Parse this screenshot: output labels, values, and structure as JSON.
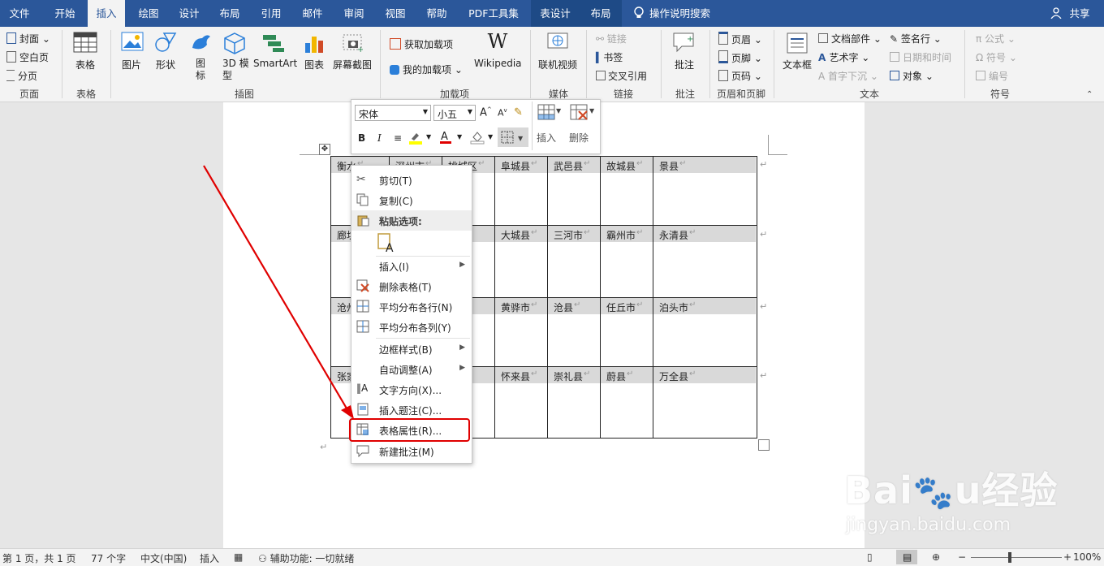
{
  "tabs": [
    "文件",
    "开始",
    "插入",
    "绘图",
    "设计",
    "布局",
    "引用",
    "邮件",
    "审阅",
    "视图",
    "帮助",
    "PDF工具集",
    "表设计",
    "布局"
  ],
  "tell_me": "操作说明搜索",
  "share": "共享",
  "ribbon": {
    "pages": {
      "label": "页面",
      "items": [
        "封面",
        "空白页",
        "分页"
      ]
    },
    "tables": {
      "label": "表格",
      "table": "表格"
    },
    "illustrations": {
      "label": "插图",
      "picture": "图片",
      "shapes": "形状",
      "icons": "图\n标",
      "model3d": "3D 模\n型",
      "smartart": "SmartArt",
      "chart": "图表",
      "screenshot": "屏幕截图"
    },
    "addins": {
      "label": "加载项",
      "get": "获取加载项",
      "mine": "我的加载项",
      "wikipedia": "Wikipedia"
    },
    "media": {
      "label": "媒体",
      "video": "联机视频"
    },
    "links": {
      "label": "链接",
      "link": "链接",
      "bookmark": "书签",
      "crossref": "交叉引用"
    },
    "comments": {
      "label": "批注",
      "comment": "批注"
    },
    "headerfooter": {
      "label": "页眉和页脚",
      "header": "页眉",
      "footer": "页脚",
      "pagenum": "页码"
    },
    "text": {
      "label": "文本",
      "textbox": "文本框",
      "quickparts": "文档部件",
      "wordart": "艺术字",
      "dropcap": "首字下沉",
      "signature": "签名行",
      "datetime": "日期和时间",
      "object": "对象"
    },
    "symbols": {
      "label": "符号",
      "equation": "公式",
      "symbol": "符号",
      "number": "编号"
    }
  },
  "mini_toolbar": {
    "font": "宋体",
    "size": "小五",
    "insert": "插入",
    "delete": "删除",
    "bold": "B",
    "italic": "I"
  },
  "table_cells": [
    [
      "衡水",
      "深州市",
      "桃城区",
      "阜城县",
      "武邑县",
      "故城县",
      "景县"
    ],
    [
      "廊坊",
      "",
      "",
      "大城县",
      "三河市",
      "霸州市",
      "永清县"
    ],
    [
      "沧州",
      "",
      "",
      "黄骅市",
      "沧县",
      "任丘市",
      "泊头市"
    ],
    [
      "张家口",
      "",
      "",
      "怀来县",
      "崇礼县",
      "蔚县",
      "万全县"
    ]
  ],
  "context_menu": {
    "cut": "剪切(T)",
    "copy": "复制(C)",
    "paste_header": "粘贴选项:",
    "insert": "插入(I)",
    "delete_table": "删除表格(T)",
    "dist_rows": "平均分布各行(N)",
    "dist_cols": "平均分布各列(Y)",
    "border": "边框样式(B)",
    "autofit": "自动调整(A)",
    "text_dir": "文字方向(X)...",
    "caption": "插入题注(C)...",
    "table_props": "表格属性(R)...",
    "new_comment": "新建批注(M)"
  },
  "status": {
    "page": "第 1 页，共 1 页",
    "words": "77 个字",
    "lang": "中文(中国)",
    "mode": "插入",
    "accessibility": "辅助功能: 一切就绪",
    "zoom": "100%"
  },
  "watermark": "Baidu经验 jingyan.baidu.com",
  "colors": {
    "accent": "#2b579a",
    "highlight": "#e00000"
  }
}
